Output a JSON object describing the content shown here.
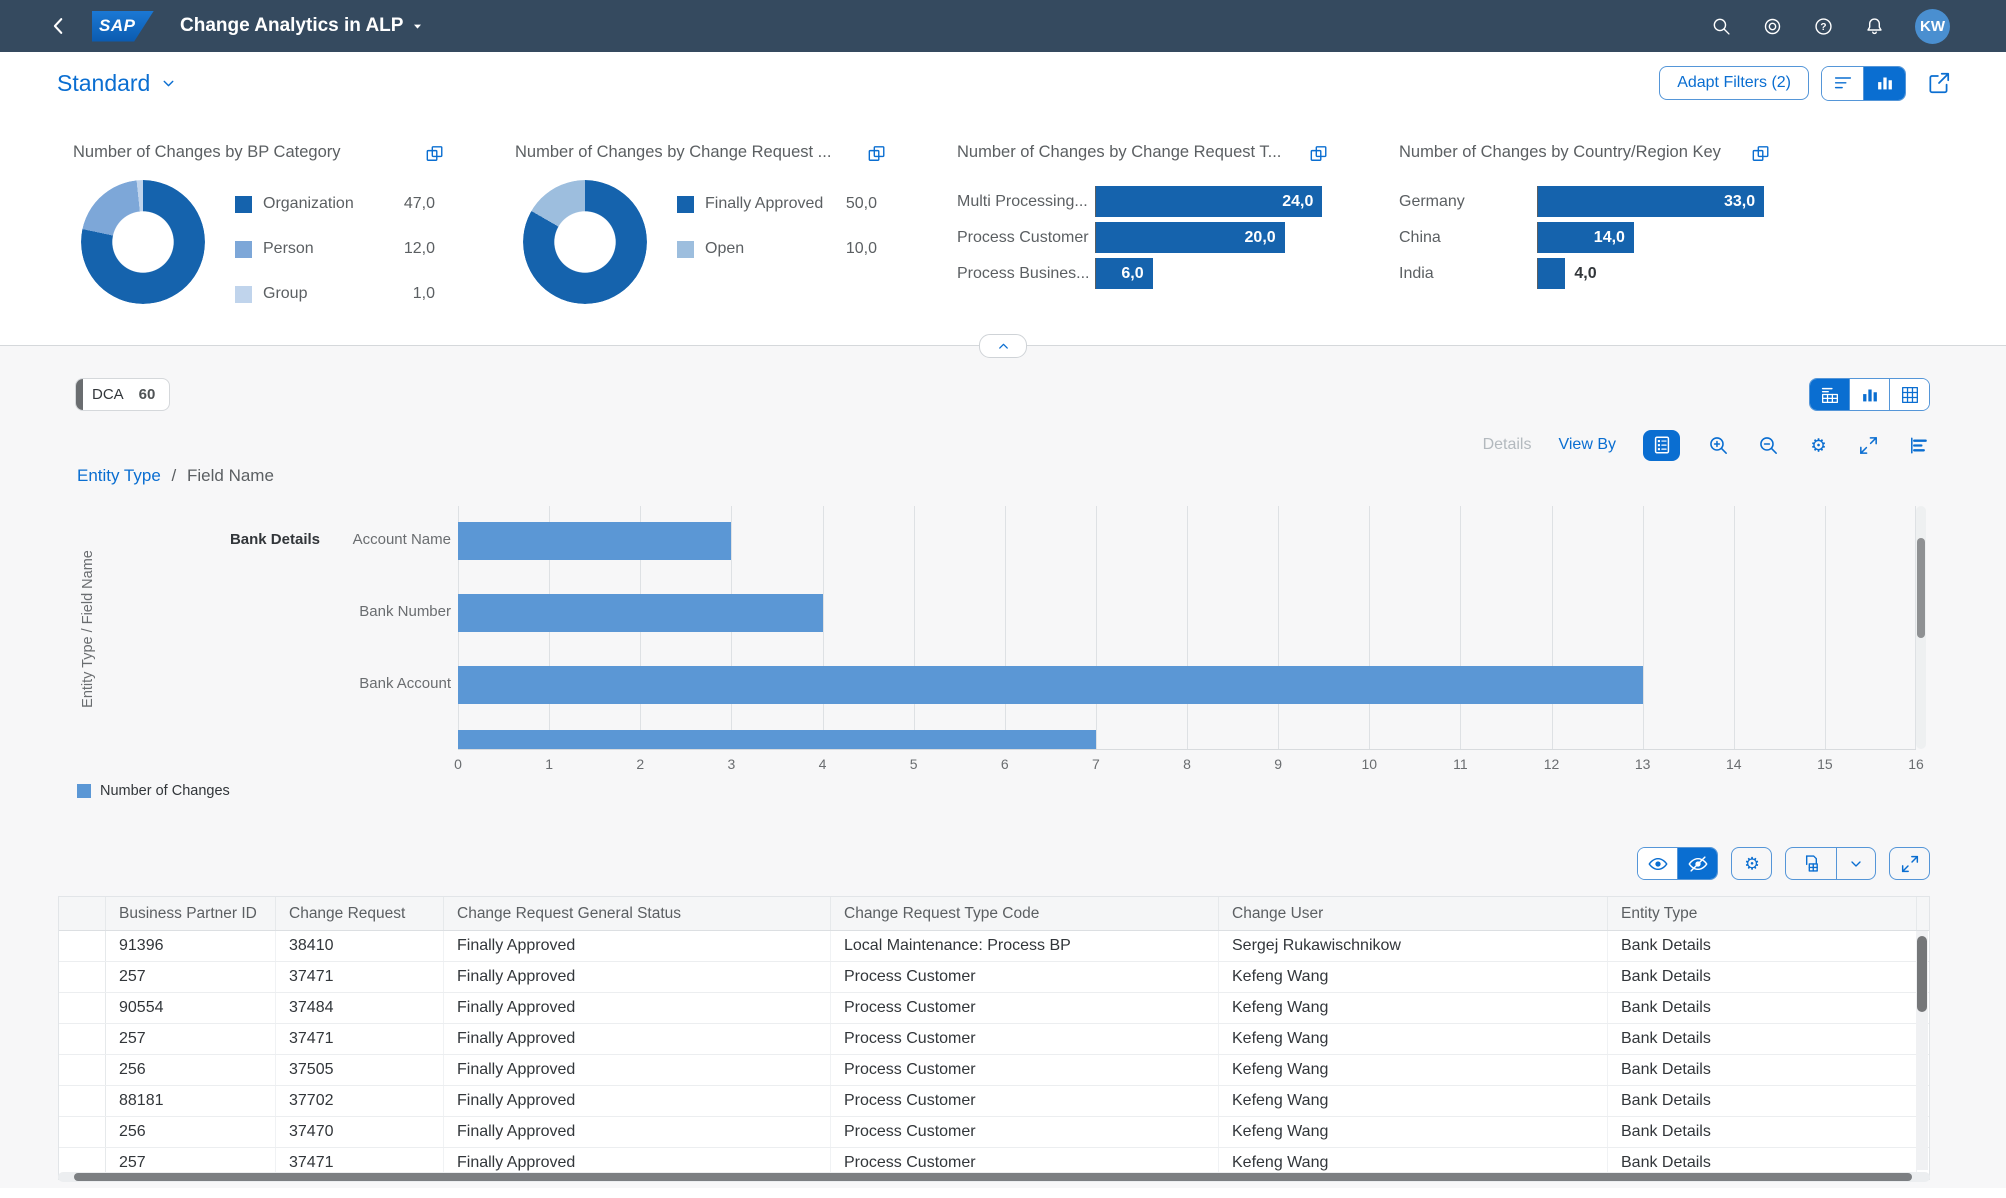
{
  "shell": {
    "logo_text": "SAP",
    "title": "Change Analytics in ALP",
    "avatar_initials": "KW"
  },
  "filter_bar": {
    "variant_label": "Standard",
    "adapt_filters_label": "Adapt Filters (2)"
  },
  "content_header": {
    "chip_label": "DCA",
    "chip_count": "60"
  },
  "chart_toolbar": {
    "details_label": "Details",
    "view_by_label": "View By"
  },
  "colors": {
    "shell_bg": "#354a5f",
    "accent_blue": "#0a6ed1",
    "kpi_dark_blue": "#1563ad",
    "kpi_medium_blue": "#7da7d8",
    "kpi_light_blue": "#c0d4ec",
    "main_bar_blue": "#5b97d5"
  },
  "chart_data": [
    {
      "id": "bp_category",
      "type": "donut",
      "title": "Number of Changes by BP Category",
      "total": 60,
      "slices": [
        {
          "label": "Organization",
          "value": 47,
          "value_label": "47,0",
          "color": "#1563ad"
        },
        {
          "label": "Person",
          "value": 12,
          "value_label": "12,0",
          "color": "#7da7d8"
        },
        {
          "label": "Group",
          "value": 1,
          "value_label": "1,0",
          "color": "#c0d4ec"
        }
      ]
    },
    {
      "id": "cr_status",
      "type": "donut",
      "title": "Number of Changes by Change Request ...",
      "total": 60,
      "slices": [
        {
          "label": "Finally Approved",
          "value": 50,
          "value_label": "50,0",
          "color": "#1563ad"
        },
        {
          "label": "Open",
          "value": 10,
          "value_label": "10,0",
          "color": "#9dbede"
        }
      ]
    },
    {
      "id": "cr_type",
      "type": "bar",
      "title": "Number of Changes by Change Request T...",
      "xmax": 24.7,
      "bar_color": "#1563ad",
      "bars": [
        {
          "label": "Multi Processing...",
          "value": 24,
          "value_label": "24,0"
        },
        {
          "label": "Process Customer",
          "value": 20,
          "value_label": "20,0"
        },
        {
          "label": "Process Busines...",
          "value": 6,
          "value_label": "6,0"
        }
      ]
    },
    {
      "id": "country",
      "type": "bar",
      "title": "Number of Changes by Country/Region Key",
      "xmax": 34,
      "bar_color": "#1563ad",
      "bars": [
        {
          "label": "Germany",
          "value": 33,
          "value_label": "33,0"
        },
        {
          "label": "China",
          "value": 14,
          "value_label": "14,0"
        },
        {
          "label": "India",
          "value": 4,
          "value_label": "4,0",
          "label_outside": true
        }
      ]
    },
    {
      "id": "main",
      "type": "bar",
      "breadcrumb": {
        "link": "Entity Type",
        "separator": "/",
        "current": "Field Name"
      },
      "axis_title": "Entity Type / Field Name",
      "group_label": "Bank Details",
      "categories": [
        "Account Name",
        "Bank Number",
        "Bank Account",
        ""
      ],
      "values": [
        3,
        4,
        13,
        7
      ],
      "partial_last_row": true,
      "xlim": [
        0,
        16
      ],
      "x_ticks": [
        0,
        1,
        2,
        3,
        4,
        5,
        6,
        7,
        8,
        9,
        10,
        11,
        12,
        13,
        14,
        15,
        16
      ],
      "bar_color": "#5b97d5",
      "legend": [
        "Number of Changes"
      ]
    }
  ],
  "table": {
    "columns": [
      "Business Partner ID",
      "Change Request",
      "Change Request General Status",
      "Change Request Type Code",
      "Change User",
      "Entity Type"
    ],
    "rows": [
      [
        "91396",
        "38410",
        "Finally Approved",
        "Local Maintenance: Process BP",
        "Sergej Rukawischnikow",
        "Bank Details"
      ],
      [
        "257",
        "37471",
        "Finally Approved",
        "Process Customer",
        "Kefeng Wang",
        "Bank Details"
      ],
      [
        "90554",
        "37484",
        "Finally Approved",
        "Process Customer",
        "Kefeng Wang",
        "Bank Details"
      ],
      [
        "257",
        "37471",
        "Finally Approved",
        "Process Customer",
        "Kefeng Wang",
        "Bank Details"
      ],
      [
        "256",
        "37505",
        "Finally Approved",
        "Process Customer",
        "Kefeng Wang",
        "Bank Details"
      ],
      [
        "88181",
        "37702",
        "Finally Approved",
        "Process Customer",
        "Kefeng Wang",
        "Bank Details"
      ],
      [
        "256",
        "37470",
        "Finally Approved",
        "Process Customer",
        "Kefeng Wang",
        "Bank Details"
      ],
      [
        "257",
        "37471",
        "Finally Approved",
        "Process Customer",
        "Kefeng Wang",
        "Bank Details"
      ]
    ]
  }
}
